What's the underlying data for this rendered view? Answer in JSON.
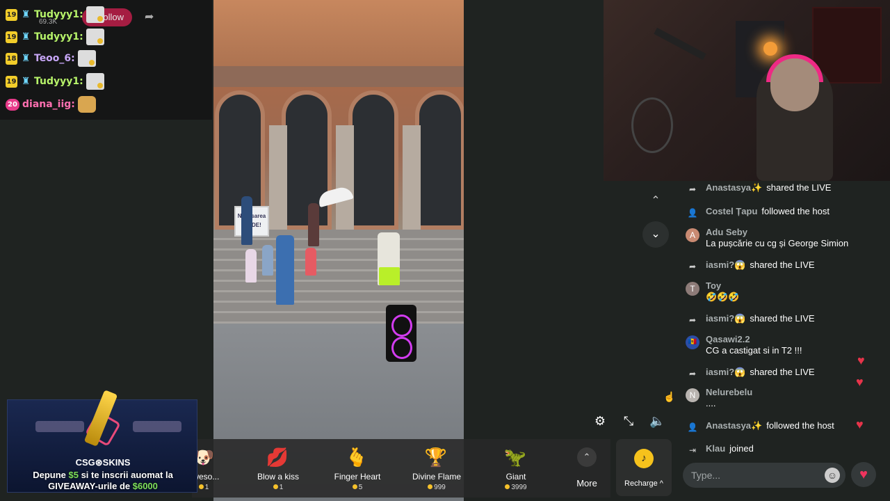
{
  "overlay_chat": {
    "follow_label": "Follow",
    "viewer_count": "69.3K",
    "messages": [
      {
        "level": "19",
        "user": "Tudyyy1:"
      },
      {
        "level": "19",
        "user": "Tudyyy1:"
      },
      {
        "level": "18",
        "user": "Teoo_6:"
      },
      {
        "level": "19",
        "user": "Tudyyy1:"
      },
      {
        "level": "20",
        "user": "diana_iig:"
      }
    ]
  },
  "video": {
    "sign_line1": "Nepăsarea",
    "sign_line2": "UCIDE!"
  },
  "ad": {
    "logo": "CSG⊛SKINS",
    "line1_a": "Depune ",
    "line1_amount": "$5",
    "line1_b": " si te inscrii auomat la",
    "line2_a": "GIVEAWAY-urile de ",
    "line2_amount": "$6000"
  },
  "gifts": [
    {
      "name": "aweso...",
      "price": "1",
      "icon": "🐶"
    },
    {
      "name": "Blow a kiss",
      "price": "1",
      "icon": "💋"
    },
    {
      "name": "Finger Heart",
      "price": "5",
      "icon": "🫰"
    },
    {
      "name": "Divine Flame",
      "price": "999",
      "icon": "🏆"
    },
    {
      "name": "Giant",
      "price": "3999",
      "icon": "🦖"
    }
  ],
  "more_label": "More",
  "recharge_label": "Recharge ^",
  "chat": [
    {
      "type": "event",
      "icon": "share-icon",
      "user": "Anastasya✨",
      "action": "shared the LIVE"
    },
    {
      "type": "event",
      "icon": "follow-icon",
      "user": "Costel Țapu",
      "action": "followed the host"
    },
    {
      "type": "message",
      "avatar": "A",
      "user": "Adu Seby",
      "text": "La pușcărie cu cg și George Simion"
    },
    {
      "type": "event",
      "icon": "share-icon",
      "user": "iasmi?😱",
      "action": "shared the LIVE"
    },
    {
      "type": "message",
      "avatar": "T",
      "user": "Toy",
      "text": "🤣🤣🤣"
    },
    {
      "type": "event",
      "icon": "share-icon",
      "user": "iasmi?😱",
      "action": "shared the LIVE"
    },
    {
      "type": "message",
      "avatar": "🇲🇩",
      "user": "Qasawi2.2",
      "text": "CG a castigat si in T2 !!!"
    },
    {
      "type": "event",
      "icon": "share-icon",
      "user": "iasmi?😱",
      "action": "shared the LIVE"
    },
    {
      "type": "message",
      "avatar": "N",
      "user": "Nelurebelu",
      "text": "...."
    },
    {
      "type": "event",
      "icon": "follow-icon",
      "user": "Anastasya✨",
      "action": "followed the host"
    },
    {
      "type": "event",
      "icon": "join-icon",
      "user": "Klau",
      "action": "joined"
    }
  ],
  "input": {
    "placeholder": "Type..."
  },
  "colors": {
    "accent": "#e6344a",
    "coin": "#f5c12b",
    "chat_user": "#a9afb0"
  }
}
